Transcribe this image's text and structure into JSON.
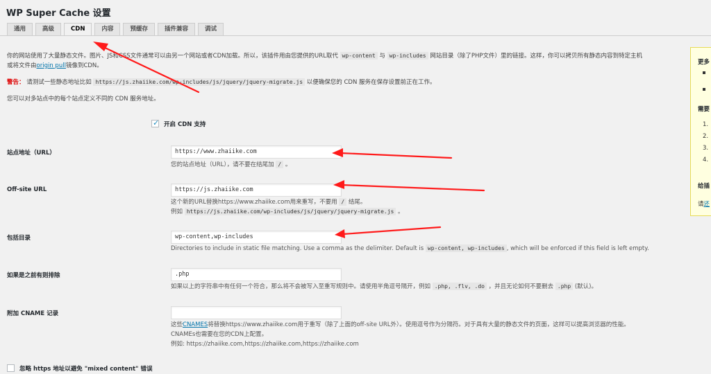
{
  "title": "WP Super Cache 设置",
  "tabs": [
    {
      "label": "通用"
    },
    {
      "label": "高级"
    },
    {
      "label": "CDN"
    },
    {
      "label": "内容"
    },
    {
      "label": "预缓存"
    },
    {
      "label": "插件兼容"
    },
    {
      "label": "调试"
    }
  ],
  "intro": {
    "line1_a": "你的网站使用了大量静态文件。图片、JS和CSS文件通常可以由另一个网站或者CDN加载。所以，该插件用由您提供的URL取代",
    "code1": "wp-content",
    "line1_b": "与",
    "code2": "wp-includes",
    "line1_c": "网站目录（除了PHP文件）里的链接。这样，你可以拷贝所有静态内容到特定主机",
    "line2_a": "或将文件由",
    "link": "origin pull",
    "line2_b": "镜像到CDN。"
  },
  "warning": {
    "label": "警告：",
    "text_a": "请测试一些静态地址比如",
    "code": "https://js.zhaiike.com/wp-includes/js/jquery/jquery-migrate.js",
    "text_b": "以便确保您的 CDN 服务在保存设置前正在工作。"
  },
  "multisite_note": "您可以对多站点中的每个站点定义不同的 CDN 服务地址。",
  "enable_cdn": {
    "label": "开启 CDN 支持",
    "checked": true
  },
  "site_url": {
    "label": "站点地址（URL）",
    "value": "https://www.zhaiike.com",
    "desc_a": "您的站点地址（URL），请不要在结尾加",
    "desc_code": "/",
    "desc_b": "。"
  },
  "offsite_url": {
    "label": "Off-site URL",
    "value": "https://js.zhaiike.com",
    "desc1_a": "这个新的URL替换https://www.zhaiike.com用来重写，不要用",
    "desc1_code": "/",
    "desc1_b": "结尾。",
    "desc2_a": "例如",
    "desc2_code": "https://js.zhaiike.com/wp-includes/js/jquery/jquery-migrate.js",
    "desc2_b": "。"
  },
  "include_dirs": {
    "label": "包括目录",
    "value": "wp-content,wp-includes",
    "desc_a": "Directories to include in static file matching. Use a comma as the delimiter. Default is",
    "desc_code": "wp-content, wp-includes",
    "desc_b": ", which will be enforced if this field is left empty."
  },
  "exclude": {
    "label": "如果是之前有则排除",
    "value": ".php",
    "desc_a": "如果以上的字符串中有任何一个符合，那么将不会被写入至重写规则中。请使用半角逗号隔开，例如",
    "code1": ".php, .flv, .do",
    "desc_b": "，并且无论如何不要删去",
    "code2": ".php",
    "desc_c": "(默认)。"
  },
  "cname": {
    "label": "附加 CNAME 记录",
    "value": "",
    "desc1_a": "这些",
    "desc1_link": "CNAMES",
    "desc1_b": "将替换https://www.zhaiike.com用于重写（除了上面的off-site URL外）。使用逗号作为分隔符。对于具有大量的静态文件的页面，这样可以提高浏览器的性能。",
    "desc2": "CNAMEs也需要在您的CDN上配置。",
    "desc3": "例如: https://zhaiike.com,https://zhaiike.com,https://zhaiike.com"
  },
  "skip_https": {
    "label": "忽略 https 地址以避免 \"mixed content\" 错误",
    "checked": false
  },
  "sidebar": {
    "heading1": "更多",
    "heading2": "需要",
    "items": [
      "1.",
      "2.",
      "3.",
      "4."
    ],
    "heading3": "给插",
    "link_text": "请",
    "link_tail": "还"
  },
  "colors": {
    "accent": "#0073aa",
    "arrow": "#ff1a1a",
    "warning": "#dd0000"
  }
}
